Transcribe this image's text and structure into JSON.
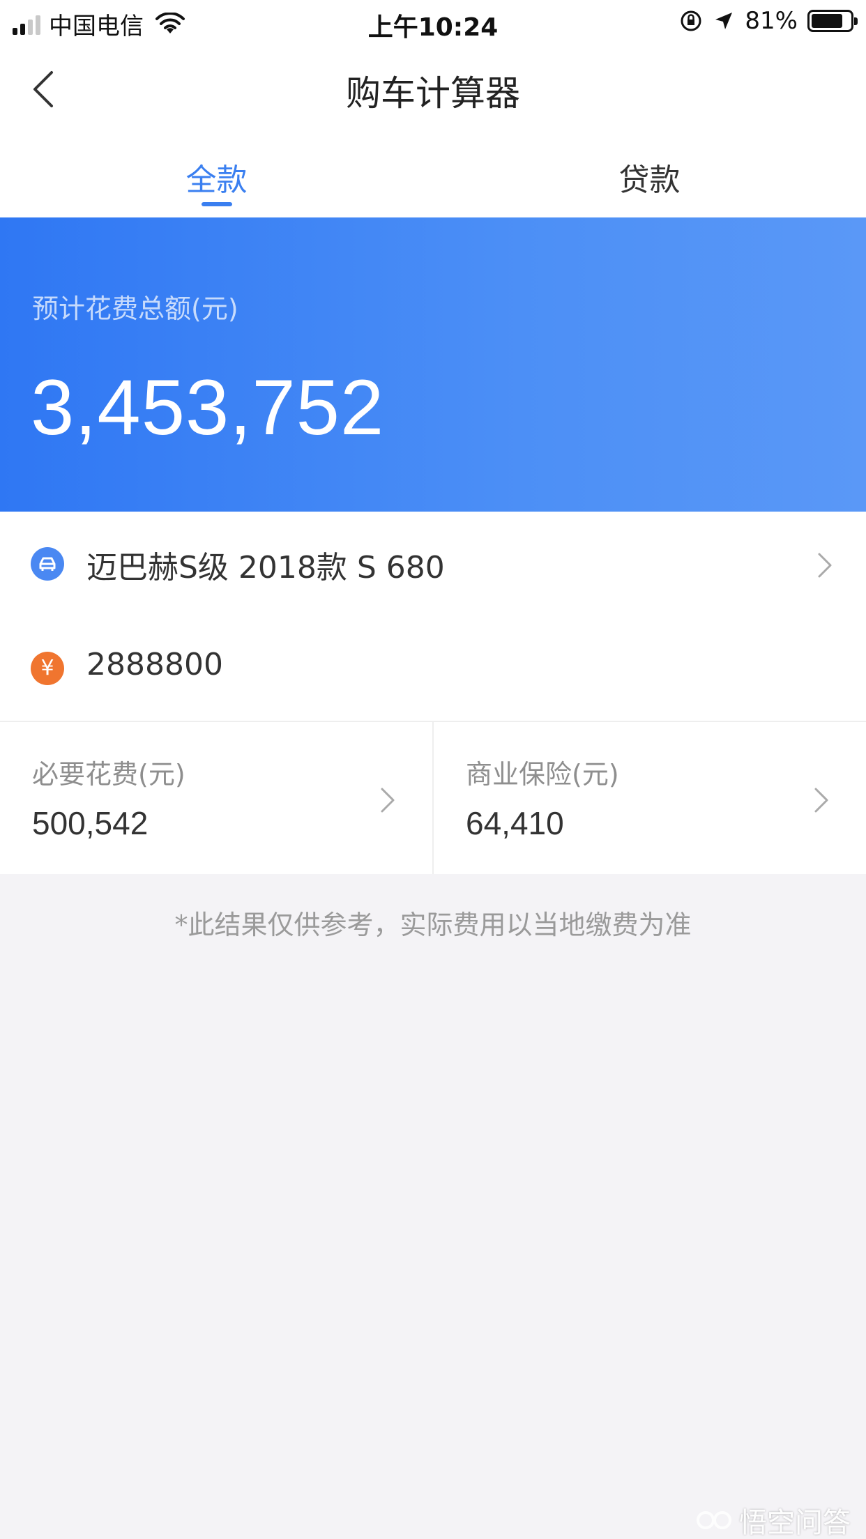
{
  "status_bar": {
    "carrier": "中国电信",
    "time": "上午10:24",
    "battery_percent": "81%",
    "battery_level": 0.81
  },
  "nav": {
    "title": "购车计算器"
  },
  "tabs": [
    {
      "label": "全款",
      "selected": true
    },
    {
      "label": "贷款",
      "selected": false
    }
  ],
  "summary": {
    "label": "预计花费总额(元)",
    "amount": "3,453,752"
  },
  "car": {
    "name": "迈巴赫S级 2018款 S 680"
  },
  "price": {
    "icon_glyph": "¥",
    "value": "2888800"
  },
  "costs": {
    "necessary": {
      "label": "必要花费(元)",
      "value": "500,542"
    },
    "insurance": {
      "label": "商业保险(元)",
      "value": "64,410"
    }
  },
  "disclaimer": "*此结果仅供参考，实际费用以当地缴费为准",
  "watermark": "悟空问答",
  "colors": {
    "accent": "#3a7ff0",
    "banner_start": "#2f77f3",
    "banner_end": "#5a98f7",
    "car_icon": "#4a88f2",
    "price_icon": "#f0752f",
    "background": "#f4f3f6"
  },
  "icons": {
    "back": "chevron-left-icon",
    "car": "car-icon",
    "price": "yuan-icon",
    "chevron": "chevron-right-icon"
  }
}
